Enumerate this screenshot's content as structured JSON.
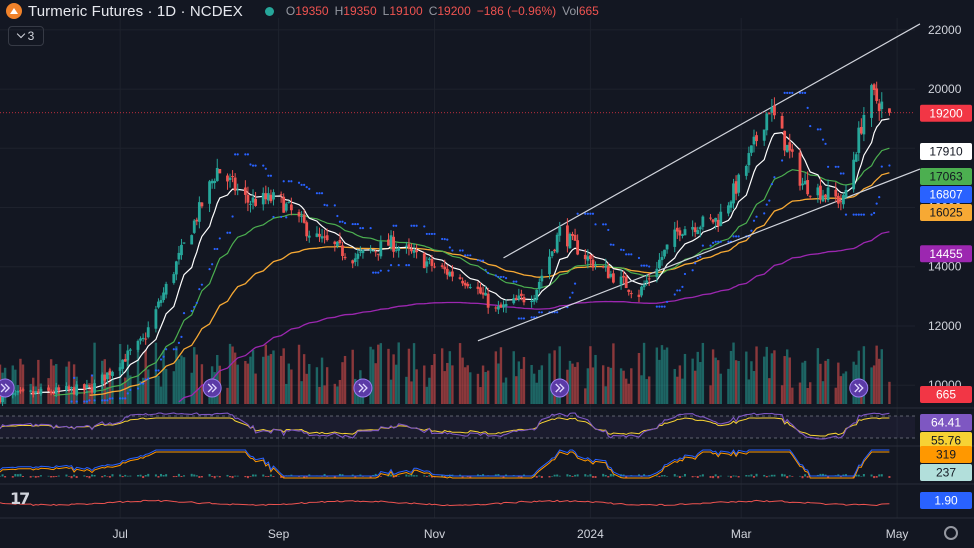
{
  "header": {
    "symbol": "Turmeric Futures · 1D · NCDEX",
    "o_label": "O",
    "o": "19350",
    "h_label": "H",
    "h": "19350",
    "l_label": "L",
    "l": "19100",
    "c_label": "C",
    "c": "19200",
    "change": "−186 (−0.96%)",
    "vol_label": "Vol",
    "vol": "665"
  },
  "indicators_badge": "3",
  "colors": {
    "background": "#131722",
    "up": "#26a69a",
    "down": "#ef5350",
    "ema_fast": "#ffffff",
    "ema_mid": "#4caf50",
    "ema_slow": "#f7a934",
    "ema_long": "#9c27b0",
    "psar": "#2962ff",
    "channel": "#d1d4dc"
  },
  "chart_data": {
    "type": "candlestick",
    "y_axis": {
      "min": 9500,
      "max": 22400,
      "ticks": [
        10000,
        12000,
        14000,
        16000,
        18000,
        20000,
        22000
      ]
    },
    "x_axis": {
      "start": "2024-05-15",
      "end": "2025-05-08",
      "ticks": [
        {
          "label": "Jul",
          "date": "2024-07-01"
        },
        {
          "label": "Sep",
          "date": "2024-09-01"
        },
        {
          "label": "Nov",
          "date": "2024-11-01"
        },
        {
          "label": "2024",
          "date": "2025-01-01"
        },
        {
          "label": "Mar",
          "date": "2025-03-01"
        },
        {
          "label": "May",
          "date": "2025-05-01"
        }
      ]
    },
    "last_close": 19200,
    "anchors": [
      [
        "2024-05-15",
        9600
      ],
      [
        "2024-06-20",
        9900
      ],
      [
        "2024-07-10",
        11500
      ],
      [
        "2024-07-25",
        14500
      ],
      [
        "2024-08-08",
        17300
      ],
      [
        "2024-08-20",
        16200
      ],
      [
        "2024-09-01",
        16300
      ],
      [
        "2024-09-15",
        15000
      ],
      [
        "2024-10-01",
        14300
      ],
      [
        "2024-10-15",
        14800
      ],
      [
        "2024-11-01",
        14000
      ],
      [
        "2024-11-15",
        13500
      ],
      [
        "2024-11-25",
        12500
      ],
      [
        "2024-12-10",
        13100
      ],
      [
        "2024-12-20",
        15200
      ],
      [
        "2025-01-01",
        14200
      ],
      [
        "2025-01-20",
        13100
      ],
      [
        "2025-02-05",
        15300
      ],
      [
        "2025-02-20",
        15600
      ],
      [
        "2025-03-01",
        17000
      ],
      [
        "2025-03-12",
        19400
      ],
      [
        "2025-03-25",
        16800
      ],
      [
        "2025-04-10",
        16200
      ],
      [
        "2025-04-20",
        19900
      ],
      [
        "2025-04-28",
        19200
      ]
    ],
    "price_labels": [
      {
        "value": 19200,
        "text": "19200",
        "color": "#f23645",
        "text_color": "#ffffff"
      },
      {
        "value": 17910,
        "text": "17910",
        "color": "#ffffff",
        "text_color": "#131722"
      },
      {
        "value": 17063,
        "text": "17063",
        "color": "#4caf50",
        "text_color": "#131722"
      },
      {
        "value": 16807,
        "text": "16807",
        "color": "#2962ff",
        "text_color": "#ffffff"
      },
      {
        "value": 16025,
        "text": "16025",
        "color": "#f7a934",
        "text_color": "#131722"
      },
      {
        "value": 14455,
        "text": "14455",
        "color": "#9c27b0",
        "text_color": "#ffffff"
      }
    ],
    "panes": {
      "volume": {
        "label": "665",
        "color": "#f23645"
      },
      "rsi": {
        "labels": [
          {
            "text": "64.41",
            "color": "#7e57c2",
            "text_color": "#ffffff"
          },
          {
            "text": "55.76",
            "color": "#f7d234",
            "text_color": "#131722"
          }
        ]
      },
      "macd": {
        "labels": [
          {
            "text": "319",
            "color": "#ff9800",
            "text_color": "#131722"
          },
          {
            "text": "237",
            "color": "#b2dfdb",
            "text_color": "#131722"
          }
        ]
      },
      "osc": {
        "labels": [
          {
            "text": "1.90",
            "color": "#2962ff",
            "text_color": "#ffffff"
          }
        ]
      }
    }
  },
  "footer": {
    "logo": "17"
  }
}
